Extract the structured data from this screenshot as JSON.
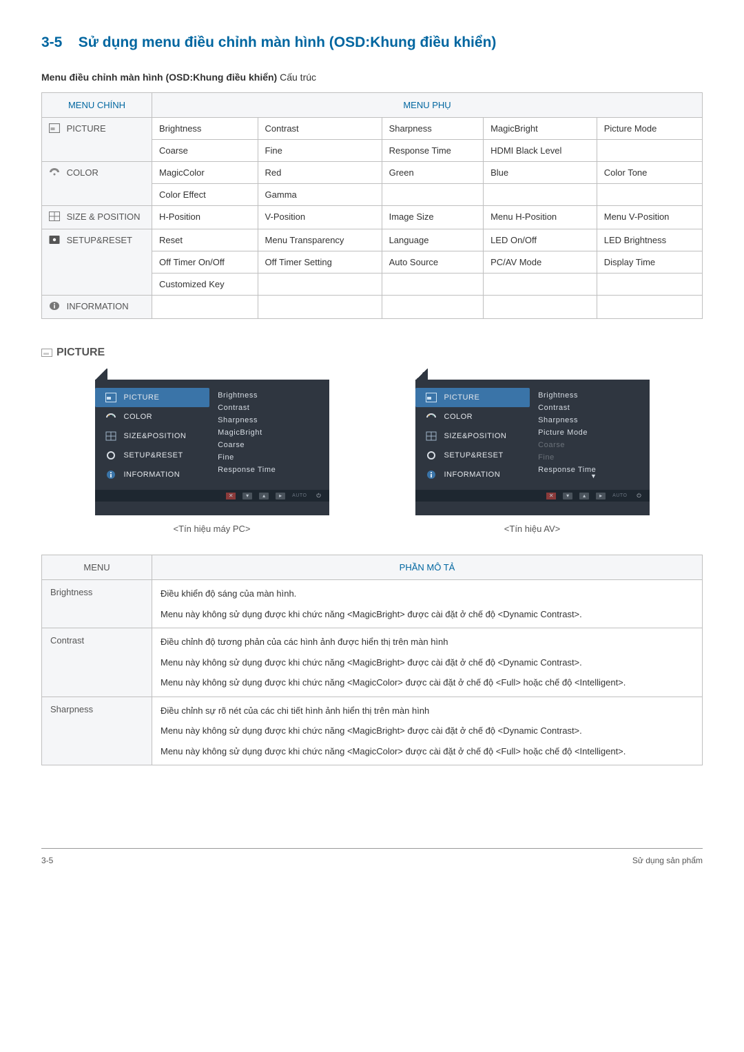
{
  "heading_num": "3-5",
  "heading_text": "Sử dụng menu điều chỉnh màn hình (OSD:Khung điều khiển)",
  "sub_bold": "Menu điều chỉnh màn hình (OSD:Khung điều khiển)",
  "sub_rest": " Cấu trúc",
  "th_main": "MENU CHÍNH",
  "th_sub": "MENU PHỤ",
  "main_menu": {
    "picture": "PICTURE",
    "color": "COLOR",
    "size": "SIZE & POSITION",
    "setup": "SETUP&RESET",
    "info": "INFORMATION"
  },
  "rows": {
    "pic1": [
      "Brightness",
      "Contrast",
      "Sharpness",
      "MagicBright",
      "Picture Mode"
    ],
    "pic2": [
      "Coarse",
      "Fine",
      "Response Time",
      "HDMI Black Level",
      ""
    ],
    "col1": [
      "MagicColor",
      "Red",
      "Green",
      "Blue",
      "Color Tone"
    ],
    "col2": [
      "Color Effect",
      "Gamma",
      "",
      "",
      ""
    ],
    "siz1": [
      "H-Position",
      "V-Position",
      "Image Size",
      "Menu H-Position",
      "Menu V-Position"
    ],
    "set1": [
      "Reset",
      "Menu Transparency",
      "Language",
      "LED On/Off",
      "LED Brightness"
    ],
    "set2": [
      "Off Timer On/Off",
      "Off Timer Setting",
      "Auto Source",
      "PC/AV Mode",
      "Display Time"
    ],
    "set3": [
      "Customized Key",
      "",
      "",
      "",
      ""
    ]
  },
  "picture_heading": "PICTURE",
  "osd_menus": {
    "items": [
      "PICTURE",
      "COLOR",
      "SIZE&POSITION",
      "SETUP&RESET",
      "INFORMATION"
    ]
  },
  "pc_opts": [
    "Brightness",
    "Contrast",
    "Sharpness",
    "MagicBright",
    "Coarse",
    "Fine",
    "Response Time"
  ],
  "av_opts": [
    {
      "t": "Brightness",
      "dim": false
    },
    {
      "t": "Contrast",
      "dim": false
    },
    {
      "t": "Sharpness",
      "dim": false
    },
    {
      "t": "Picture Mode",
      "dim": false
    },
    {
      "t": "Coarse",
      "dim": true
    },
    {
      "t": "Fine",
      "dim": true
    },
    {
      "t": "Response Time",
      "dim": false
    }
  ],
  "caption_pc": "<Tín hiệu máy PC>",
  "caption_av": "<Tín hiệu AV>",
  "ctrl_auto": "AUTO",
  "th_menu": "MENU",
  "th_desc": "PHẦN MÔ TẢ",
  "desc": {
    "brightness": {
      "name": "Brightness",
      "p1": "Điều khiển độ sáng của màn hình.",
      "p2": "Menu này không sử dụng được khi chức năng <MagicBright> được cài đặt ở chế độ <Dynamic Contrast>."
    },
    "contrast": {
      "name": "Contrast",
      "p1": "Điều chỉnh độ tương phản của các hình ảnh được hiển thị trên màn hình",
      "p2": "Menu này không sử dụng được khi chức năng <MagicBright> được cài đặt ở chế độ <Dynamic Contrast>.",
      "p3": "Menu này không sử dụng được khi chức năng <MagicColor> được cài đặt ở chế độ <Full> hoặc chế độ <Intelligent>."
    },
    "sharpness": {
      "name": "Sharpness",
      "p1": "Điều chỉnh sự rõ nét của các chi tiết hình ảnh hiển thị trên màn hình",
      "p2": "Menu này không sử dụng được khi chức năng <MagicBright> được cài đặt ở chế độ <Dynamic Contrast>.",
      "p3": "Menu này không sử dụng được khi chức năng <MagicColor> được cài đặt ở chế độ <Full> hoặc chế độ <Intelligent>."
    }
  },
  "footer_left": "3-5",
  "footer_right": "Sử dụng sản phẩm"
}
